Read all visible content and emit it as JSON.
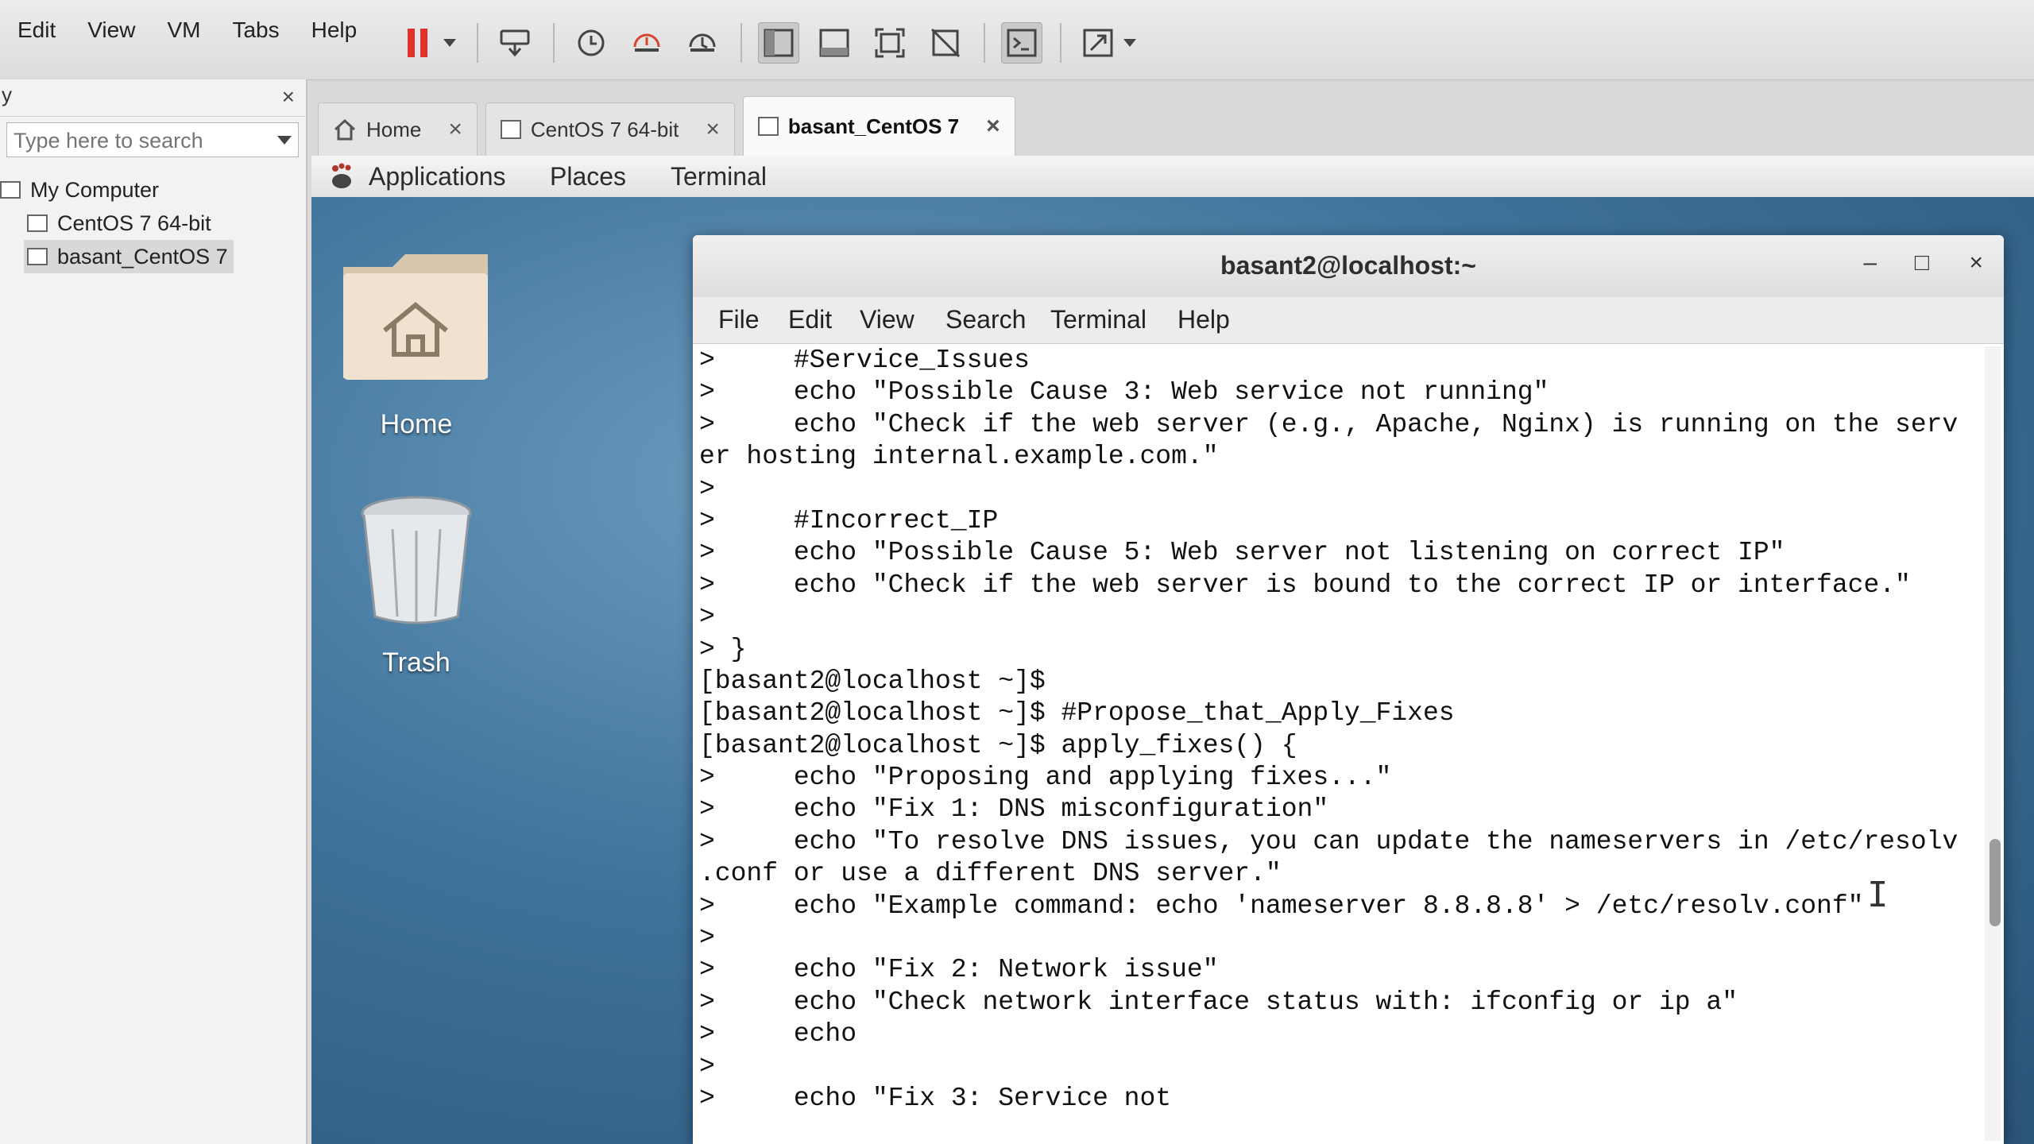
{
  "menubar": [
    "Edit",
    "View",
    "VM",
    "Tabs",
    "Help"
  ],
  "sidebar": {
    "title": "y",
    "close": "×",
    "search_placeholder": "Type here to search",
    "root": "My Computer",
    "items": [
      "CentOS 7 64-bit",
      "basant_CentOS 7"
    ]
  },
  "tabs": [
    {
      "label": "Home",
      "close": "×"
    },
    {
      "label": "CentOS 7 64-bit",
      "close": "×"
    },
    {
      "label": "basant_CentOS 7",
      "close": "×"
    }
  ],
  "gnome_bar": {
    "applications": "Applications",
    "places": "Places",
    "terminal": "Terminal"
  },
  "desktop": {
    "home": "Home",
    "trash": "Trash"
  },
  "terminal": {
    "title": "basant2@localhost:~",
    "minimize": "–",
    "maximize": "□",
    "close": "×",
    "menu": [
      "File",
      "Edit",
      "View",
      "Search",
      "Terminal",
      "Help"
    ],
    "lines": [
      ">     #Service_Issues",
      ">     echo \"Possible Cause 3: Web service not running\"",
      ">     echo \"Check if the web server (e.g., Apache, Nginx) is running on the serv",
      "er hosting internal.example.com.\"",
      ">",
      ">     #Incorrect_IP",
      ">     echo \"Possible Cause 5: Web server not listening on correct IP\"",
      ">     echo \"Check if the web server is bound to the correct IP or interface.\"",
      ">",
      "> }",
      "[basant2@localhost ~]$",
      "[basant2@localhost ~]$ #Propose_that_Apply_Fixes",
      "[basant2@localhost ~]$ apply_fixes() {",
      ">     echo \"Proposing and applying fixes...\"",
      ">     echo \"Fix 1: DNS misconfiguration\"",
      ">     echo \"To resolve DNS issues, you can update the nameservers in /etc/resolv",
      ".conf or use a different DNS server.\"",
      ">     echo \"Example command: echo 'nameserver 8.8.8.8' > /etc/resolv.conf\"",
      ">",
      ">     echo \"Fix 2: Network issue\"",
      ">     echo \"Check network interface status with: ifconfig or ip a\"",
      ">     echo",
      ">",
      ">     echo \"Fix 3: Service not"
    ]
  },
  "text_cursor": "I"
}
